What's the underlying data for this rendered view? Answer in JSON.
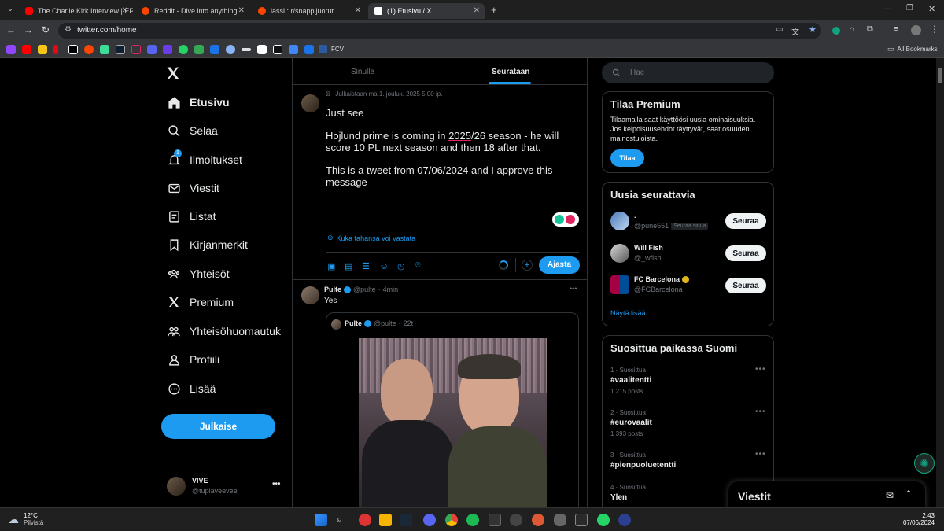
{
  "browser": {
    "tabs": [
      {
        "title": "The Charlie Kirk Interview | EP.",
        "color": "#ff0000"
      },
      {
        "title": "Reddit - Dive into anything",
        "color": "#ff4500"
      },
      {
        "title": "lassi : r/snappijuorut",
        "color": "#ff4500"
      },
      {
        "title": "(1) Etusivu / X",
        "color": "#ffffff"
      }
    ],
    "new_tab": "+",
    "url": "twitter.com/home",
    "bookmark_label": "FCV",
    "all_bookmarks": "All Bookmarks"
  },
  "sidebar": {
    "items": [
      {
        "label": "Etusivu",
        "icon": "home-icon"
      },
      {
        "label": "Selaa",
        "icon": "search-icon"
      },
      {
        "label": "Ilmoitukset",
        "icon": "bell-icon",
        "badge": "1"
      },
      {
        "label": "Viestit",
        "icon": "mail-icon"
      },
      {
        "label": "Listat",
        "icon": "list-icon"
      },
      {
        "label": "Kirjanmerkit",
        "icon": "bookmark-icon"
      },
      {
        "label": "Yhteisöt",
        "icon": "communities-icon"
      },
      {
        "label": "Premium",
        "icon": "x-icon"
      },
      {
        "label": "Yhteisöhuomautuk",
        "icon": "community-notes-icon"
      },
      {
        "label": "Profiili",
        "icon": "profile-icon"
      },
      {
        "label": "Lisää",
        "icon": "more-icon"
      }
    ],
    "post_button": "Julkaise",
    "account": {
      "name": "VIVE",
      "handle": "@tuplaveevee"
    }
  },
  "timeline": {
    "tabs": [
      "Sinulle",
      "Seurataan"
    ],
    "composer": {
      "scheduled": "Julkaistaan ma 1. jouluk. 2025 5.00 ip.",
      "line1": "Just see",
      "line2a": "Hojlund prime is coming in ",
      "line2b": "2025",
      "line2c": "/26 season - he will score 10 PL next season and then 18 after that.",
      "line3": "This is a tweet from 07/06/2024 and I approve this message",
      "reply_setting": "Kuka tahansa voi vastata",
      "schedule_button": "Ajasta"
    },
    "tweet": {
      "name": "Pulte",
      "handle": "@pulte",
      "time": "4min",
      "text": "Yes",
      "quote": {
        "name": "Pulte",
        "handle": "@pulte",
        "time": "22t"
      }
    }
  },
  "right": {
    "search_placeholder": "Hae",
    "premium": {
      "title": "Tilaa Premium",
      "text": "Tilaamalla saat käyttöösi uusia ominaisuuksia. Jos kelpoisuusehdot täyttyvät, saat osuuden mainostuloista.",
      "button": "Tilaa"
    },
    "who_to_follow": {
      "title": "Uusia seurattavia",
      "users": [
        {
          "name": ".",
          "handle": "@pune551",
          "badge": "Seuraa sinua",
          "button": "Seuraa"
        },
        {
          "name": "Will Fish",
          "handle": "@_wfish",
          "button": "Seuraa"
        },
        {
          "name": "FC Barcelona",
          "handle": "@FCBarcelona",
          "button": "Seuraa"
        }
      ],
      "show_more": "Näytä lisää"
    },
    "trends": {
      "title": "Suosittua paikassa Suomi",
      "items": [
        {
          "meta": "1 · Suosittua",
          "name": "#vaalitentti",
          "posts": "1 215 posts"
        },
        {
          "meta": "2 · Suosittua",
          "name": "#eurovaalit",
          "posts": "1 393 posts"
        },
        {
          "meta": "3 · Suosittua",
          "name": "#pienpuoluetentti",
          "posts": ""
        },
        {
          "meta": "4 · Suosittua",
          "name": "Ylen",
          "posts": ""
        }
      ]
    },
    "messages_drawer": "Viestit"
  },
  "taskbar": {
    "temperature": "12°C",
    "weather": "Pilvistä",
    "time": "2.43",
    "date": "07/06/2024"
  }
}
